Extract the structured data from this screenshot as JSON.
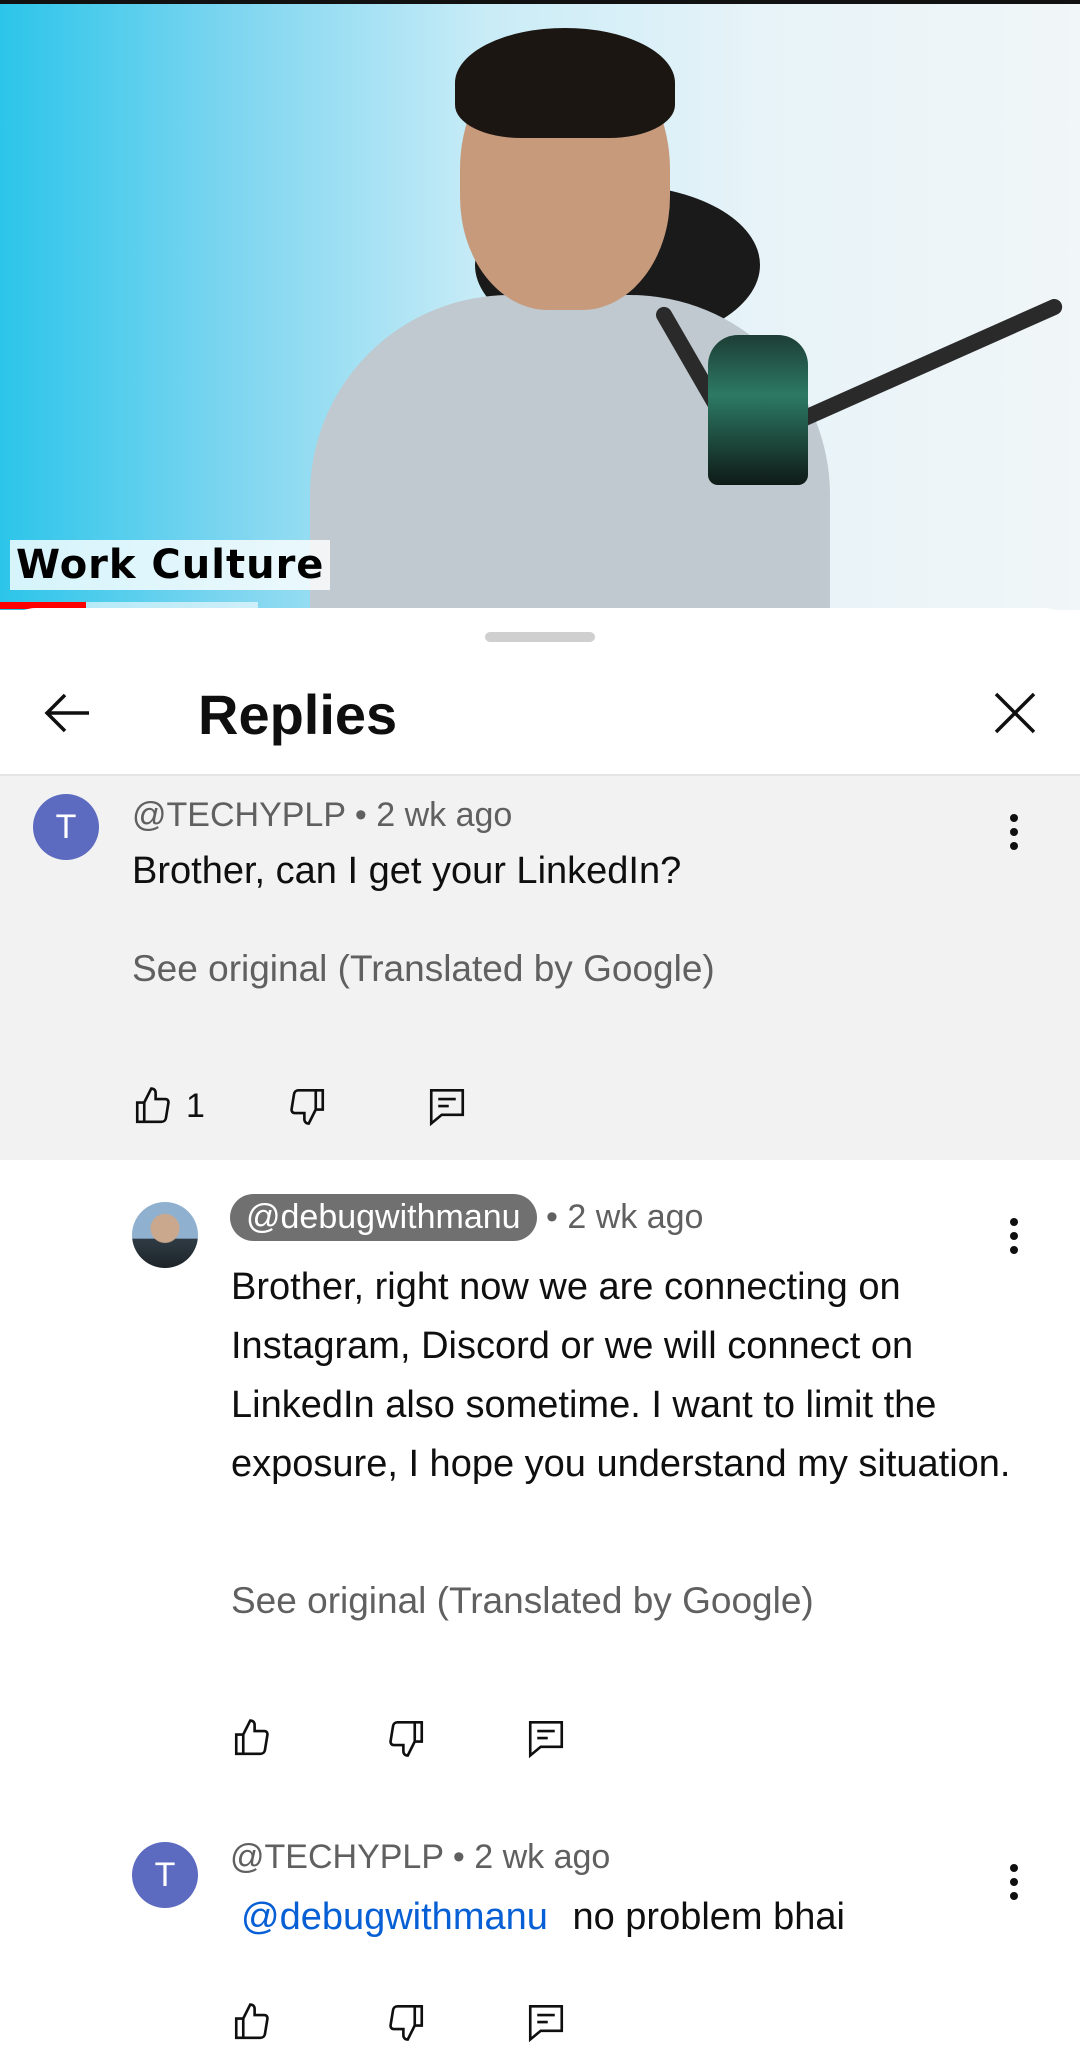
{
  "video": {
    "caption": "Work Culture",
    "progress_fraction": 0.08
  },
  "sheet": {
    "title": "Replies",
    "back_icon": "arrow-left-icon",
    "close_icon": "close-icon"
  },
  "comments": [
    {
      "avatar_letter": "T",
      "handle": "@TECHYPLP",
      "time": "• 2 wk ago",
      "text": "Brother, can I get your LinkedIn?",
      "see_original": "See original (Translated by Google)",
      "likes": "1"
    },
    {
      "handle": "@debugwithmanu",
      "time": "• 2 wk ago",
      "text": "Brother, right now we are connecting on Instagram, Discord or we will connect on LinkedIn also sometime. I want to limit the exposure, I hope you understand my situation.",
      "see_original": "See original (Translated by Google)"
    },
    {
      "avatar_letter": "T",
      "handle": "@TECHYPLP",
      "time": "• 2 wk ago",
      "mention": "@debugwithmanu",
      "text": "no problem bhai"
    }
  ],
  "colors": {
    "accent_red": "#ff0000",
    "avatar_purple": "#5c6bc0",
    "mention_blue": "#065fd4"
  }
}
